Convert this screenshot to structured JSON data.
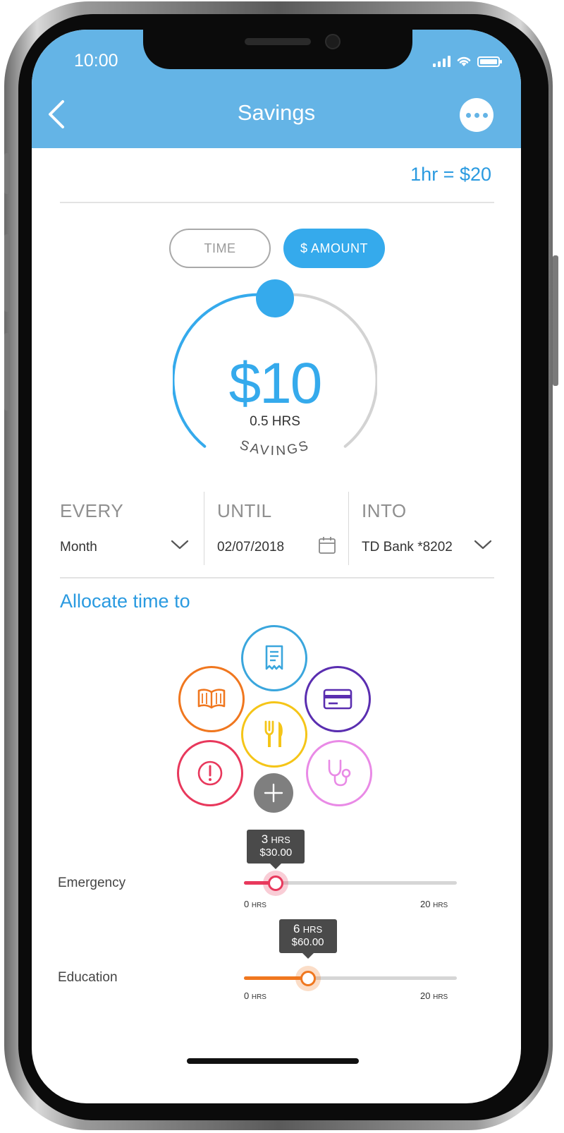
{
  "status_bar": {
    "time": "10:00"
  },
  "header": {
    "title": "Savings"
  },
  "rate": {
    "label": "1hr = $20"
  },
  "mode_toggle": {
    "time_label": "TIME",
    "amount_label": "$ AMOUNT",
    "selected": "$ AMOUNT"
  },
  "dial": {
    "amount": "$10",
    "hours": "0.5 HRS",
    "caption": "SAVINGS",
    "progress_fraction": 0.5
  },
  "schedule": {
    "every": {
      "label": "EVERY",
      "value": "Month"
    },
    "until": {
      "label": "UNTIL",
      "value": "02/07/2018"
    },
    "into": {
      "label": "INTO",
      "value": "TD Bank *8202"
    }
  },
  "allocate": {
    "title": "Allocate time to",
    "categories": [
      {
        "icon": "receipt-icon",
        "color": "#3aa6dd"
      },
      {
        "icon": "book-icon",
        "color": "#f0771f"
      },
      {
        "icon": "credit-card-icon",
        "color": "#5a2eb0"
      },
      {
        "icon": "fork-knife-icon",
        "color": "#f5c518"
      },
      {
        "icon": "alert-icon",
        "color": "#e8385c"
      },
      {
        "icon": "stethoscope-icon",
        "color": "#e98ae6"
      },
      {
        "icon": "plus-icon",
        "color": "#7f7f7f"
      }
    ]
  },
  "sliders": [
    {
      "label": "Emergency",
      "hrs_num": "3",
      "hrs_unit": "HRS",
      "amount": "$30.00",
      "min_num": "0",
      "max_num": "20",
      "unit": "HRS",
      "value_fraction": 0.15,
      "color": "#e8385c"
    },
    {
      "label": "Education",
      "hrs_num": "6",
      "hrs_unit": "HRS",
      "amount": "$60.00",
      "min_num": "0",
      "max_num": "20",
      "unit": "HRS",
      "value_fraction": 0.3,
      "color": "#f0771f"
    }
  ],
  "colors": {
    "header": "#64b4e6",
    "accent": "#35aaec",
    "link": "#2a9ae0"
  }
}
